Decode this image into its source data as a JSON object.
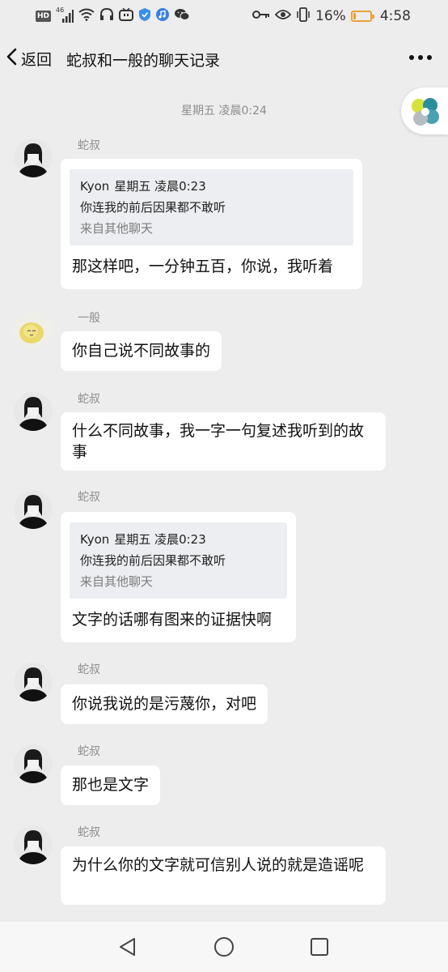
{
  "status_bar": {
    "left_icons": [
      "hd-icon",
      "signal-icon",
      "wifi-icon",
      "headphones-icon",
      "tv-app-icon",
      "shield-app-icon",
      "music-app-icon",
      "wechat-icon"
    ],
    "right_icons": [
      "key-icon",
      "eye-icon",
      "vibrate-icon"
    ],
    "hd_label": "HD",
    "signal_label": "46",
    "battery_percent_text": "16%",
    "battery_level": 0.16,
    "time": "4:58"
  },
  "nav": {
    "back_label": "返回",
    "title": "蛇叔和一般的聊天记录"
  },
  "timestamp": "星期五 凌晨0:24",
  "messages": [
    {
      "sender": "蛇叔",
      "quote": {
        "author": "Kyon",
        "time": "星期五 凌晨0:23",
        "text": "你连我的前后因果都不敢听",
        "from": "来自其他聊天"
      },
      "text": "那这样吧，一分钟五百，你说，我听着"
    },
    {
      "sender": "一般",
      "text": "你自己说不同故事的"
    },
    {
      "sender": "蛇叔",
      "text": "什么不同故事，我一字一句复述我听到的故事"
    },
    {
      "sender": "蛇叔",
      "quote": {
        "author": "Kyon",
        "time": "星期五 凌晨0:23",
        "text": "你连我的前后因果都不敢听",
        "from": "来自其他聊天"
      },
      "text": "文字的话哪有图来的证据快啊"
    },
    {
      "sender": "蛇叔",
      "text": "你说我说的是污蔑你，对吧"
    },
    {
      "sender": "蛇叔",
      "text": "那也是文字"
    },
    {
      "sender": "蛇叔",
      "text": "为什么你的文字就可信别人说的就是造谣呢"
    }
  ],
  "colors": {
    "background": "#ededed",
    "bubble": "#ffffff",
    "quote_bg": "#eceef1",
    "muted_text": "#8d8d8d",
    "battery": "#f29a2e"
  }
}
